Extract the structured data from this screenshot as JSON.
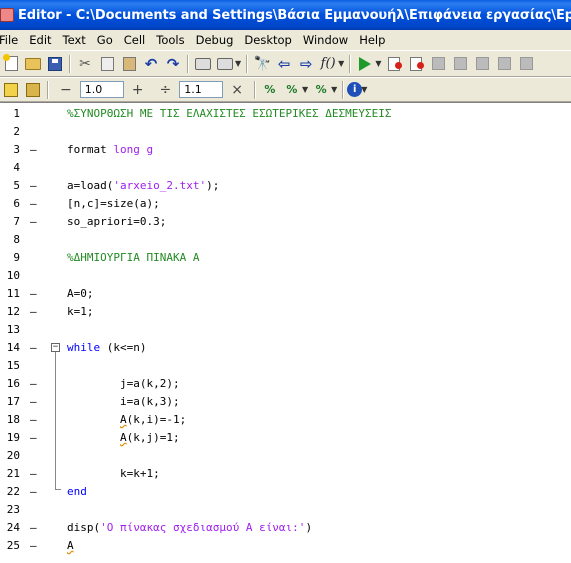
{
  "window": {
    "title": "Editor - C:\\Documents and Settings\\Βάσια Εμμανουήλ\\Επιφάνεια εργασίας\\Epilysi_diktyou_"
  },
  "menubar": {
    "items": [
      "File",
      "Edit",
      "Text",
      "Go",
      "Cell",
      "Tools",
      "Debug",
      "Desktop",
      "Window",
      "Help"
    ]
  },
  "toolbar": {
    "icons": [
      "new-file-icon",
      "open-file-icon",
      "save-icon",
      "cut-icon",
      "copy-icon",
      "paste-icon",
      "undo-icon",
      "redo-icon",
      "print-icon",
      "print-options-icon",
      "find-icon",
      "back-icon",
      "forward-icon",
      "function-icon",
      "run-icon",
      "set-breakpoint-icon",
      "clear-breakpoints-icon",
      "step-icon",
      "step-in-icon",
      "step-out-icon",
      "continue-icon",
      "exit-debug-icon"
    ]
  },
  "cell_toolbar": {
    "minus": "−",
    "value1": "1.0",
    "plus": "+",
    "divide": "÷",
    "value2": "1.1",
    "times": "×",
    "icons": [
      "eval-cell-icon",
      "eval-cell-advance-icon",
      "insert-cell-divider-icon",
      "percent-insert-icon",
      "percent-remove-icon",
      "info-icon"
    ]
  },
  "editor": {
    "lines": [
      {
        "n": "1",
        "marker": "",
        "code": [
          {
            "t": "cmt",
            "v": "%ΣΥΝΟΡΘΩΣΗ ΜΕ ΤΙΣ ΕΛΑΧΙΣΤΕΣ ΕΣΩΤΕΡΙΚΕΣ ΔΕΣΜΕΥΣΕΙΣ"
          }
        ]
      },
      {
        "n": "2",
        "marker": "",
        "code": []
      },
      {
        "n": "3",
        "marker": "–",
        "code": [
          {
            "t": "",
            "v": "format "
          },
          {
            "t": "str",
            "v": "long g"
          }
        ]
      },
      {
        "n": "4",
        "marker": "",
        "code": []
      },
      {
        "n": "5",
        "marker": "–",
        "code": [
          {
            "t": "",
            "v": "a=load("
          },
          {
            "t": "str",
            "v": "'arxeio_2.txt'"
          },
          {
            "t": "",
            "v": ");"
          }
        ]
      },
      {
        "n": "6",
        "marker": "–",
        "code": [
          {
            "t": "",
            "v": "[n,c]=size(a);"
          }
        ]
      },
      {
        "n": "7",
        "marker": "–",
        "code": [
          {
            "t": "",
            "v": "so_apriori=0.3;"
          }
        ]
      },
      {
        "n": "8",
        "marker": "",
        "code": []
      },
      {
        "n": "9",
        "marker": "",
        "code": [
          {
            "t": "cmt",
            "v": "%ΔΗΜΙΟΥΡΓΙΑ ΠΙΝΑΚΑ A"
          }
        ]
      },
      {
        "n": "10",
        "marker": "",
        "code": []
      },
      {
        "n": "11",
        "marker": "–",
        "code": [
          {
            "t": "",
            "v": "A=0;"
          }
        ]
      },
      {
        "n": "12",
        "marker": "–",
        "code": [
          {
            "t": "",
            "v": "k=1;"
          }
        ]
      },
      {
        "n": "13",
        "marker": "",
        "code": []
      },
      {
        "n": "14",
        "marker": "–",
        "code": [
          {
            "t": "kw",
            "v": "while"
          },
          {
            "t": "",
            "v": " (k<=n)"
          }
        ]
      },
      {
        "n": "15",
        "marker": "",
        "code": []
      },
      {
        "n": "16",
        "marker": "–",
        "code": [
          {
            "t": "",
            "v": "        j=a(k,2);"
          }
        ]
      },
      {
        "n": "17",
        "marker": "–",
        "code": [
          {
            "t": "",
            "v": "        i=a(k,3);"
          }
        ]
      },
      {
        "n": "18",
        "marker": "–",
        "code": [
          {
            "t": "",
            "v": "        "
          },
          {
            "t": "warn",
            "v": "A"
          },
          {
            "t": "",
            "v": "(k,i)=-1;"
          }
        ]
      },
      {
        "n": "19",
        "marker": "–",
        "code": [
          {
            "t": "",
            "v": "        "
          },
          {
            "t": "warn",
            "v": "A"
          },
          {
            "t": "",
            "v": "(k,j)=1;"
          }
        ]
      },
      {
        "n": "20",
        "marker": "",
        "code": []
      },
      {
        "n": "21",
        "marker": "–",
        "code": [
          {
            "t": "",
            "v": "        k=k+1;"
          }
        ]
      },
      {
        "n": "22",
        "marker": "–",
        "code": [
          {
            "t": "kw",
            "v": "end"
          }
        ]
      },
      {
        "n": "23",
        "marker": "",
        "code": []
      },
      {
        "n": "24",
        "marker": "–",
        "code": [
          {
            "t": "",
            "v": "disp("
          },
          {
            "t": "str",
            "v": "'Ο πίνακας σχεδιασμού A είναι:'"
          },
          {
            "t": "",
            "v": ")"
          }
        ]
      },
      {
        "n": "25",
        "marker": "–",
        "code": [
          {
            "t": "warn",
            "v": "A"
          }
        ]
      }
    ]
  }
}
